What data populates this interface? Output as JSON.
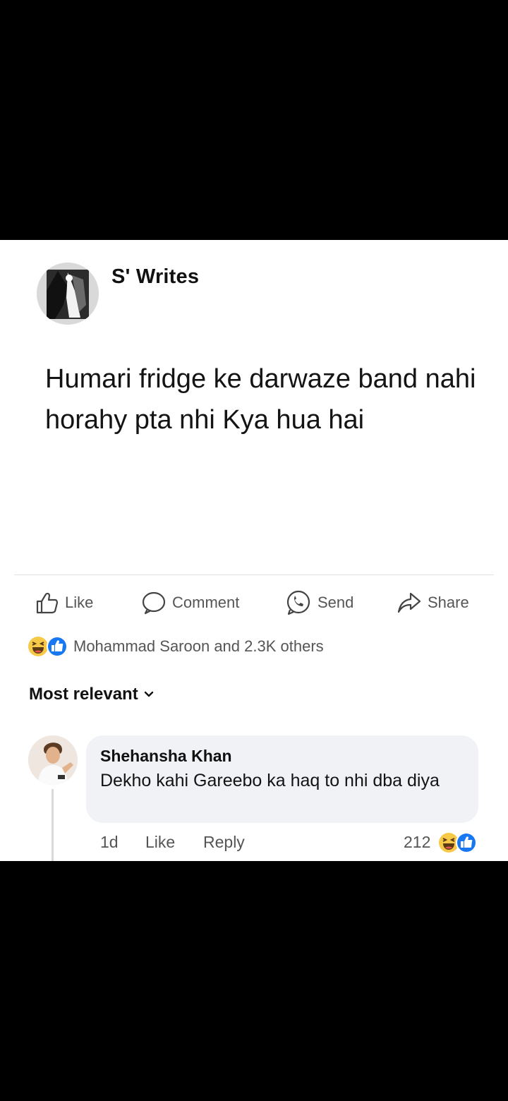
{
  "post": {
    "author": "S' Writes",
    "text": "Humari fridge ke darwaze band nahi horahy pta nhi Kya hua hai"
  },
  "actions": {
    "like": "Like",
    "comment": "Comment",
    "send": "Send",
    "share": "Share"
  },
  "reactions": {
    "icons": [
      "haha-icon",
      "like-icon"
    ],
    "summary": "Mohammad Saroon and 2.3K others"
  },
  "comments_sort": {
    "label": "Most relevant"
  },
  "comment": {
    "author": "Shehansha Khan",
    "text": "Dekho kahi Gareebo ka haq to nhi dba diya",
    "time": "1d",
    "like": "Like",
    "reply": "Reply",
    "reaction_count": "212"
  },
  "colors": {
    "like_blue": "#1877f2",
    "haha_yellow": "#f7c948",
    "meta_gray": "#555555",
    "bubble_bg": "#f0f2f5"
  }
}
